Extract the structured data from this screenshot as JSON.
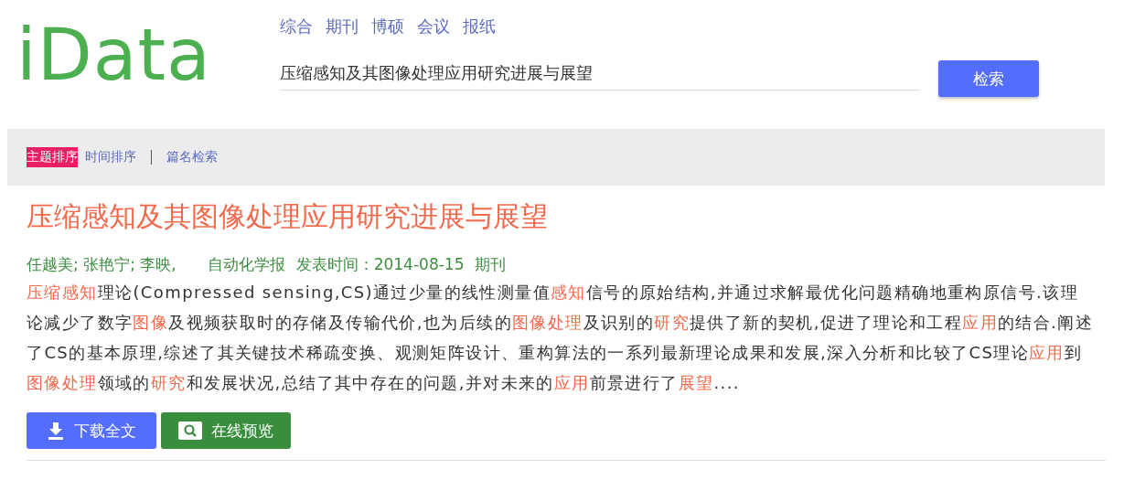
{
  "logo": "iData",
  "nav": [
    {
      "label": "综合"
    },
    {
      "label": "期刊"
    },
    {
      "label": "博硕"
    },
    {
      "label": "会议"
    },
    {
      "label": "报纸"
    }
  ],
  "search": {
    "value": "压缩感知及其图像处理应用研究进展与展望",
    "button": "检索"
  },
  "sort_options": [
    {
      "label": "主题排序",
      "selected": true
    },
    {
      "label": "时间排序",
      "selected": false
    }
  ],
  "title_search_link": "篇名检索",
  "result": {
    "title": "压缩感知及其图像处理应用研究进展与展望",
    "authors": "任越美; 张艳宁; 李映,",
    "journal": "自动化学报",
    "date": "发表时间：2014-08-15",
    "type": "期刊",
    "abstract": [
      {
        "text": "压缩感知",
        "highlight": true
      },
      {
        "text": "理论(Compressed sensing,CS)通过少量的线性测量值",
        "highlight": false
      },
      {
        "text": "感知",
        "highlight": true
      },
      {
        "text": "信号的原始结构,并通过求解最优化问题精确地重构原信号.该理论减少了数字",
        "highlight": false
      },
      {
        "text": "图像",
        "highlight": true
      },
      {
        "text": "及视频获取时的存储及传输代价,也为后续的",
        "highlight": false
      },
      {
        "text": "图像处理",
        "highlight": true
      },
      {
        "text": "及识别的",
        "highlight": false
      },
      {
        "text": "研究",
        "highlight": true
      },
      {
        "text": "提供了新的契机,促进了理论和工程",
        "highlight": false
      },
      {
        "text": "应用",
        "highlight": true
      },
      {
        "text": "的结合.阐述了CS的基本原理,综述了其关键技术稀疏变换、观测矩阵设计、重构算法的一系列最新理论成果和发展,深入分析和比较了CS理论",
        "highlight": false
      },
      {
        "text": "应用",
        "highlight": true
      },
      {
        "text": "到",
        "highlight": false
      },
      {
        "text": "图像处理",
        "highlight": true
      },
      {
        "text": "领域的",
        "highlight": false
      },
      {
        "text": "研究",
        "highlight": true
      },
      {
        "text": "和发展状况,总结了其中存在的问题,并对未来的",
        "highlight": false
      },
      {
        "text": "应用",
        "highlight": true
      },
      {
        "text": "前景进行了",
        "highlight": false
      },
      {
        "text": "展望",
        "highlight": true
      },
      {
        "text": "....",
        "highlight": false
      }
    ],
    "download_button": "下载全文",
    "preview_button": "在线预览"
  }
}
